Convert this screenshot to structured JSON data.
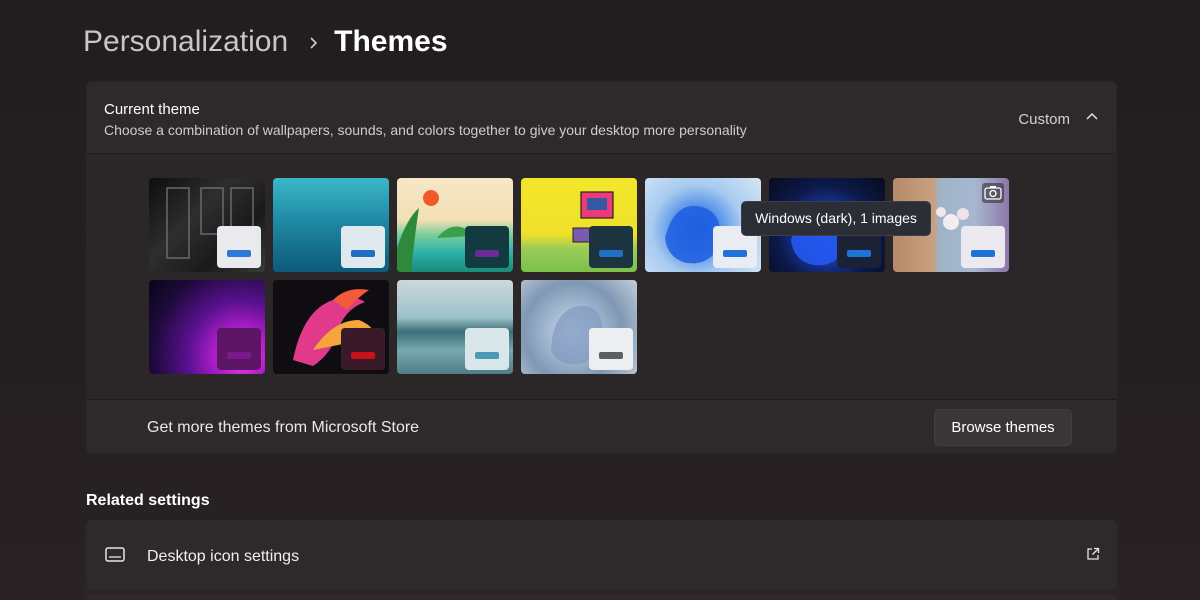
{
  "breadcrumb": {
    "parent": "Personalization",
    "current": "Themes"
  },
  "current_theme": {
    "title": "Current theme",
    "subtitle": "Choose a combination of wallpapers, sounds, and colors together to give your desktop more personality",
    "value": "Custom"
  },
  "themes": [
    {
      "name": "theme-dark-text",
      "accent": "#2b7bd6"
    },
    {
      "name": "theme-underwater",
      "accent": "#1f6fc4"
    },
    {
      "name": "theme-glow-landscape",
      "accent": "#6b2a9a"
    },
    {
      "name": "theme-retro-computer",
      "accent": "#1f6fc4"
    },
    {
      "name": "theme-windows-light",
      "accent": "#1f73d6"
    },
    {
      "name": "theme-windows-dark",
      "accent": "#1f73d6"
    },
    {
      "name": "theme-flowers",
      "accent": "#1f73d6"
    },
    {
      "name": "theme-glow",
      "accent": "#7a1a8a"
    },
    {
      "name": "theme-captured-motion",
      "accent": "#c8121a"
    },
    {
      "name": "theme-sunrise",
      "accent": "#4a9ab3"
    },
    {
      "name": "theme-flow",
      "accent": "#5a5f66"
    }
  ],
  "tooltip": "Windows (dark), 1 images",
  "store": {
    "label": "Get more themes from Microsoft Store",
    "button": "Browse themes"
  },
  "related": {
    "title": "Related settings",
    "desktop_icon_settings": "Desktop icon settings"
  },
  "colors": {
    "accent": "#1f73d6",
    "background": "#221e1f",
    "card": "#2e2a2b"
  }
}
